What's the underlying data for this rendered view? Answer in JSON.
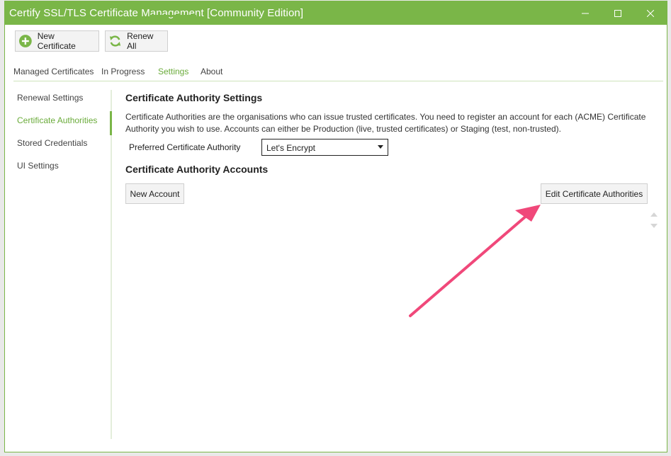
{
  "window": {
    "title": "Certify SSL/TLS Certificate Management [Community Edition]",
    "accent_color": "#7ab648"
  },
  "titlebar_buttons": {
    "minimize_icon": "minimize-icon",
    "maximize_icon": "maximize-icon",
    "close_icon": "close-icon"
  },
  "toolbar": {
    "new_certificate_label": "New Certificate",
    "renew_all_label": "Renew All"
  },
  "tabs": [
    {
      "label": "Managed Certificates"
    },
    {
      "label": "In Progress"
    },
    {
      "label": "Settings",
      "active": true
    },
    {
      "label": "About"
    }
  ],
  "sidebar": {
    "items": [
      {
        "label": "Renewal Settings"
      },
      {
        "label": "Certificate Authorities",
        "active": true
      },
      {
        "label": "Stored Credentials"
      },
      {
        "label": "UI Settings"
      }
    ]
  },
  "main": {
    "ca_settings_heading": "Certificate Authority Settings",
    "ca_settings_description": "Certificate Authorities are the organisations who can issue trusted certificates. You need to register an account for each (ACME) Certificate Authority you wish to use. Accounts can either be Production (live, trusted certificates) or Staging (test, non-trusted).",
    "preferred_ca_label": "Preferred Certificate Authority",
    "preferred_ca_value": "Let's Encrypt",
    "ca_accounts_heading": "Certificate Authority Accounts",
    "new_account_label": "New Account",
    "edit_cas_label": "Edit Certificate Authorities"
  },
  "annotation": {
    "arrow_color": "#f0487a"
  }
}
